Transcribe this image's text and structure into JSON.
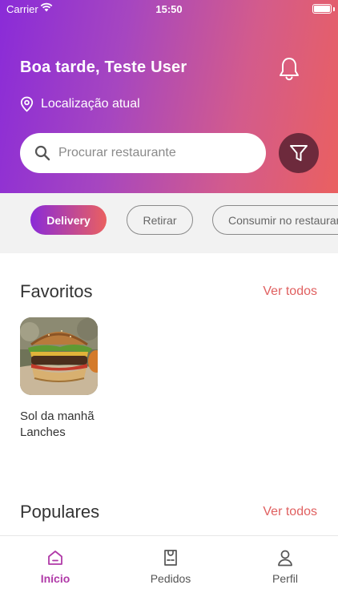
{
  "status_bar": {
    "carrier": "Carrier",
    "time": "15:50"
  },
  "header": {
    "greeting": "Boa tarde, Teste User",
    "location": "Localização atual"
  },
  "search": {
    "placeholder": "Procurar restaurante",
    "value": ""
  },
  "delivery_modes": [
    "Delivery",
    "Retirar",
    "Consumir no restaurante"
  ],
  "favorites": {
    "title": "Favoritos",
    "see_all": "Ver todos",
    "items": [
      {
        "name": "Sol da manhã Lanches"
      }
    ]
  },
  "popular": {
    "title": "Populares",
    "see_all": "Ver todos"
  },
  "tabs": [
    {
      "label": "Início",
      "icon": "home-icon",
      "active": true
    },
    {
      "label": "Pedidos",
      "icon": "receipt-icon",
      "active": false
    },
    {
      "label": "Perfil",
      "icon": "user-icon",
      "active": false
    }
  ],
  "colors": {
    "gradient_start": "#8a2bd8",
    "gradient_end": "#ea6060",
    "accent_text": "#e06060",
    "active_tab": "#b03aa8",
    "filter_button": "#6d2a3c"
  }
}
